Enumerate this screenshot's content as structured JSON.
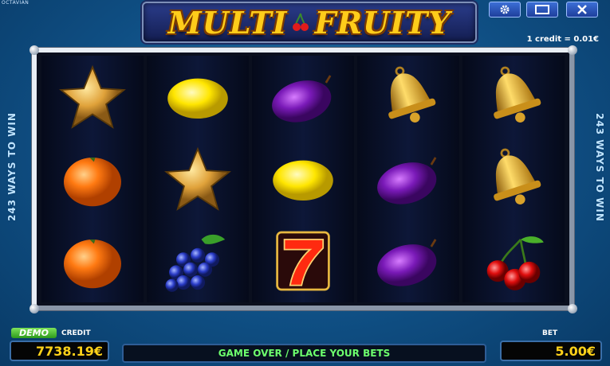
{
  "brand": "OCTAVIAN",
  "logo": {
    "word1": "MULTI",
    "word2": "FRUITY"
  },
  "top_buttons": [
    "settings",
    "window",
    "close"
  ],
  "credit_value_text": "1 credit = 0.01€",
  "side_text": "243 WAYS TO WIN",
  "reels": [
    [
      "star",
      "orange",
      "orange"
    ],
    [
      "lemon",
      "star",
      "grapes"
    ],
    [
      "plum",
      "lemon",
      "seven"
    ],
    [
      "bell",
      "plum",
      "plum"
    ],
    [
      "bell",
      "bell",
      "cherries"
    ]
  ],
  "bottom": {
    "demo": "DEMO",
    "credit_label": "CREDIT",
    "credit": "7738.19€",
    "message": "GAME OVER / PLACE YOUR BETS",
    "bet_label": "BET",
    "bet": "5.00€",
    "message2": ""
  },
  "colors": {
    "accent": "#ffd21a",
    "message": "#6dff6d",
    "background": "#0f4f84"
  }
}
